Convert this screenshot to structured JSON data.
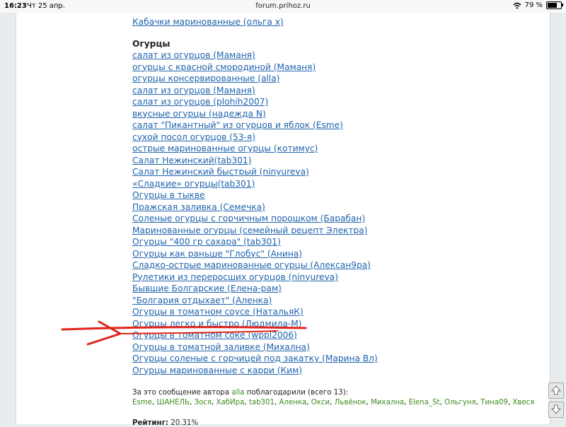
{
  "status": {
    "time": "16:23",
    "date": "Чт 25 апр.",
    "url": "forum.prihoz.ru",
    "battery": "79 %",
    "battery_level": 0.79
  },
  "top_link": "Кабачки маринованные (ольга х)",
  "section_title": "Огурцы",
  "links": [
    "салат из огурцов (Маманя)",
    "огурцы с красной смородиной (Маманя)",
    "огурцы консервированные (alla)",
    "салат из огурцов (Маманя)",
    "салат из огурцов (plohih2007)",
    "вкусные огурцы (надежда N)",
    "салат \"Пикантный\" из огурцов и яблок (Esme)",
    "сухой посол огурцов (53-я)",
    "острые маринованные огурцы (котимус)",
    "Салат Нежинский(tab301)",
    "Салат Нежинский быстрый (ninyureva)",
    "«Сладкие» огурцы(tab301)",
    "Огурцы в тыкве",
    "Пражская заливка (Семечка)",
    "Соленые огурцы с горчичным порошком (Барабан)",
    "Маринованные огурцы (семейный рецепт Электра)",
    "Огурцы \"400 гр сахара\" (tab301)",
    "Огурцы как раньше \"Глобус\" (Анина)",
    "Сладко-острые маринованные огурцы (Алексан9ра)",
    "Рулетики из переросших огурцов (ninyureva)",
    "Бывшие Болгарские (Елена-рам)",
    "\"Болгария отдыхает\" (Аленка)",
    "Огурцы в томатном соусе (НатальяК)",
    "Огурцы легко и быстро (Людмила-М)",
    "Огурцы в томатном соке (wppl2006)",
    "Огурцы в томатной заливке (Михална)",
    "Огурцы соленые с горчицей под закатку (Марина Вл)",
    "Огурцы маринованные с карри (Ким)"
  ],
  "thanks": {
    "prefix": "За это сообщение автора",
    "author": "alla",
    "suffix": "поблагодарили (всего 13):",
    "names": [
      "Esme",
      "ШАНЕЛЬ",
      "Зося",
      "ХабИра",
      "tab301",
      "Аленка",
      "Окси",
      "Львёнок",
      "Михална",
      "Elena_St",
      "Ольгуня",
      "Тина09",
      "Хвеся"
    ]
  },
  "rating": {
    "label": "Рейтинг:",
    "value": "20.31%"
  },
  "colors": {
    "link": "#1f63ad",
    "thanks_name": "#3b8c1e",
    "annotation": "#e0241b"
  }
}
